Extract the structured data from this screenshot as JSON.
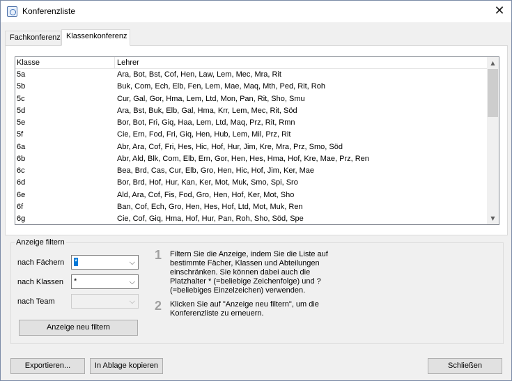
{
  "window": {
    "title": "Konferenzliste",
    "close_glyph": "✕"
  },
  "tabs": [
    {
      "label": "Fachkonferenz",
      "active": false
    },
    {
      "label": "Klassenkonferenz",
      "active": true
    }
  ],
  "list": {
    "columns": [
      "Klasse",
      "Lehrer"
    ],
    "rows": [
      {
        "klasse": "5a",
        "lehrer": "Ara, Bot, Bst, Cof, Hen, Law, Lem, Mec, Mra, Rit"
      },
      {
        "klasse": "5b",
        "lehrer": "Buk, Com, Ech, Elb, Fen, Lem, Mae, Maq, Mth, Ped, Rit, Roh"
      },
      {
        "klasse": "5c",
        "lehrer": "Cur, Gal, Gor, Hma, Lem, Ltd, Mon, Pan, Rit, Sho, Smu"
      },
      {
        "klasse": "5d",
        "lehrer": "Ara, Bst, Buk, Elb, Gal, Hma, Krr, Lem, Mec, Rit, Söd"
      },
      {
        "klasse": "5e",
        "lehrer": "Bor, Bot, Fri, Giq, Haa, Lem, Ltd, Maq, Prz, Rit, Rmn"
      },
      {
        "klasse": "5f",
        "lehrer": "Cie, Ern, Fod, Fri, Giq, Hen, Hub, Lem, Mil, Prz, Rit"
      },
      {
        "klasse": "6a",
        "lehrer": "Abr, Ara, Cof, Fri, Hes, Hic, Hof, Hur, Jim, Kre, Mra, Prz, Smo, Söd"
      },
      {
        "klasse": "6b",
        "lehrer": "Abr, Ald, Blk, Com, Elb, Ern, Gor, Hen, Hes, Hma, Hof, Kre, Mae, Prz, Ren"
      },
      {
        "klasse": "6c",
        "lehrer": "Bea, Brd, Cas, Cur, Elb, Gro, Hen, Hic, Hof, Jim, Ker, Mae"
      },
      {
        "klasse": "6d",
        "lehrer": "Bor, Brd, Hof, Hur, Kan, Ker, Mot, Muk, Smo, Spi, Sro"
      },
      {
        "klasse": "6e",
        "lehrer": "Ald, Ara, Cof, Fis, Fod, Gro, Hen, Hof, Ker, Mot, Sho"
      },
      {
        "klasse": "6f",
        "lehrer": "Ban, Cof, Ech, Gro, Hen, Hes, Hof, Ltd, Mot, Muk, Ren"
      },
      {
        "klasse": "6g",
        "lehrer": "Cie, Cof, Giq, Hma, Hof, Hur, Pan, Roh, Sho, Söd, Spe"
      }
    ]
  },
  "filter": {
    "group_title": "Anzeige filtern",
    "faecher": {
      "label": "nach Fächern",
      "value": "*"
    },
    "klassen": {
      "label": "nach Klassen",
      "value": "*"
    },
    "team": {
      "label": "nach Team",
      "value": ""
    },
    "refresh_button": "Anzeige neu filtern"
  },
  "help": {
    "step1_num": "1",
    "step1_text": "Filtern Sie die Anzeige, indem Sie die Liste auf bestimmte Fächer, Klassen und Abteilungen einschränken. Sie können dabei auch die Platzhalter * (=beliebige Zeichenfolge) und ? (=beliebiges Einzelzeichen) verwenden.",
    "step2_num": "2",
    "step2_text": "Klicken Sie auf \"Anzeige neu filtern\", um die Konferenzliste zu erneuern."
  },
  "buttons": {
    "export": "Exportieren...",
    "clipboard": "In Ablage kopieren",
    "close": "Schließen"
  },
  "icons": {
    "dropdown": "⌵",
    "scroll_up": "▲",
    "scroll_down": "▼"
  }
}
